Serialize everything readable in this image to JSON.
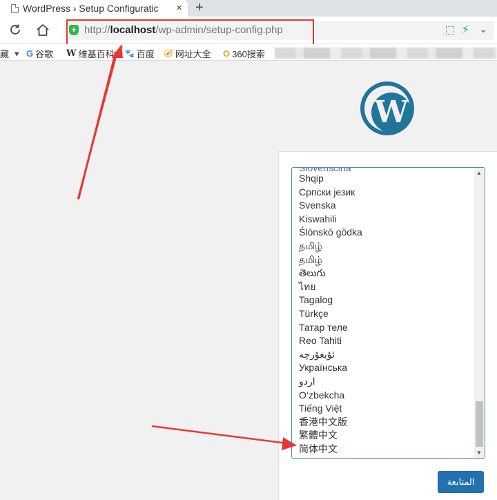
{
  "browser": {
    "tab_title": "WordPress › Setup Configuratic",
    "tab_close": "×",
    "new_tab": "+",
    "url_prefix": "http://",
    "url_host": "localhost",
    "url_path": "/wp-admin/setup-config.php"
  },
  "bookmarks": [
    {
      "icon": "",
      "label": "藏"
    },
    {
      "icon": "G",
      "label": "谷歌"
    },
    {
      "icon": "W",
      "label": "维基百科"
    },
    {
      "icon": "🐾",
      "label": "百度"
    },
    {
      "icon": "🧭",
      "label": "网址大全"
    },
    {
      "icon": "O",
      "label": "360搜索"
    }
  ],
  "logo": {
    "letter": "W"
  },
  "languages": [
    "Slovenščina",
    "Shqip",
    "Српски језик",
    "Svenska",
    "Kiswahili",
    "Ślōnskŏ gŏdka",
    "தமிழ்",
    "தமிழ்",
    "తెలుగు",
    "ไทย",
    "Tagalog",
    "Türkçe",
    "Татар теле",
    "Reo Tahiti",
    "ئۇيغۇرچە",
    "Українська",
    "اردو",
    "O‘zbekcha",
    "Tiếng Việt",
    "香港中文版",
    "繁體中文",
    "简体中文"
  ],
  "continue_label": "المتابعة",
  "colors": {
    "accent": "#2271b1",
    "annotation": "#e53935",
    "wp_blue": "#21759b"
  }
}
